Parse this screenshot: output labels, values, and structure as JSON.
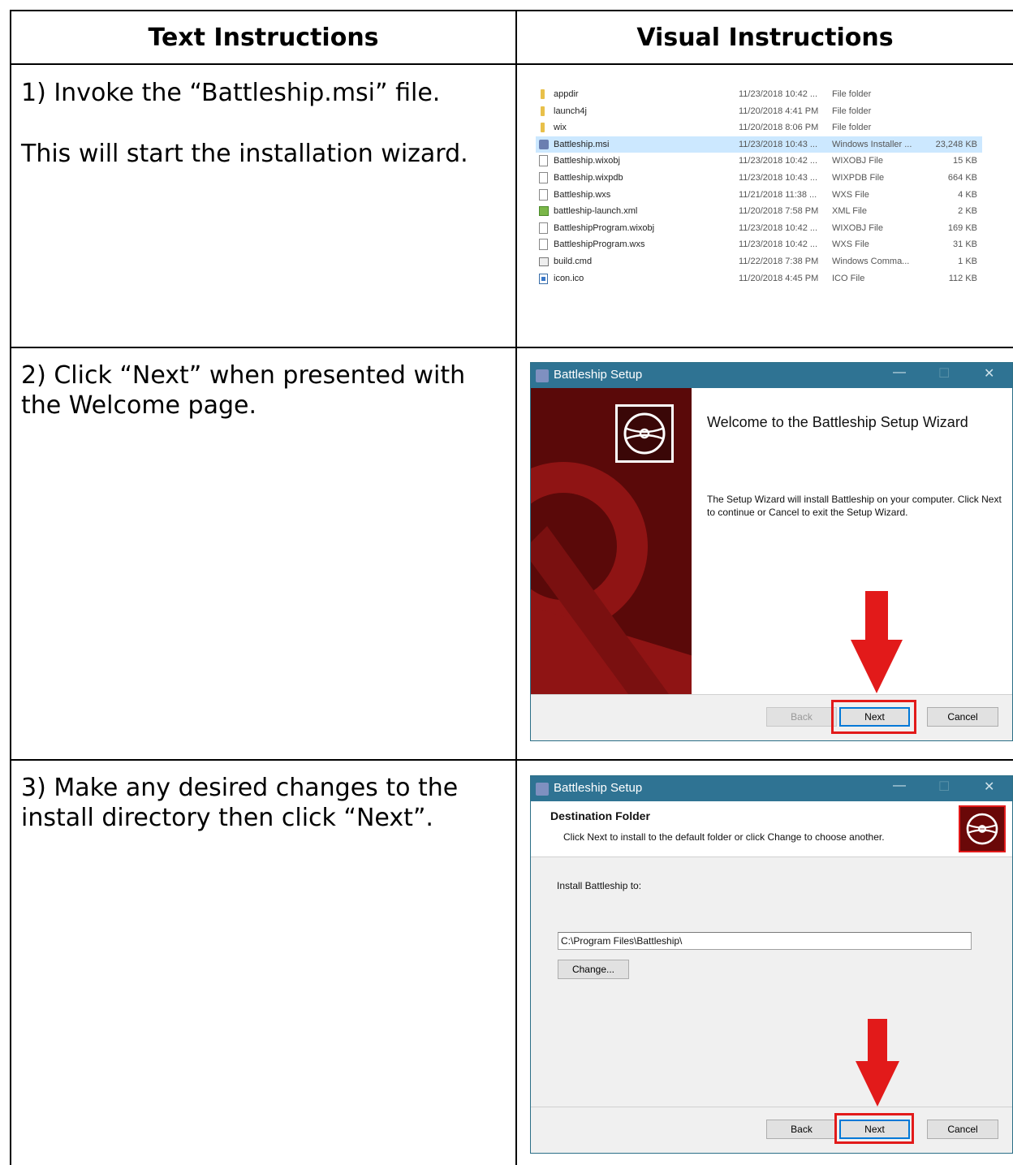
{
  "headers": {
    "text": "Text Instructions",
    "visual": "Visual Instructions"
  },
  "steps": [
    {
      "lines": [
        "1) Invoke the “Battleship.msi” file.",
        "This will start the installation wizard."
      ]
    },
    {
      "lines": [
        "2) Click “Next” when presented with the Welcome page."
      ]
    },
    {
      "lines": [
        "3) Make any desired changes to the install directory then click “Next”."
      ]
    }
  ],
  "explorer": {
    "files": [
      {
        "name": "appdir",
        "date": "11/23/2018 10:42 ...",
        "type": "File folder",
        "size": "",
        "icon": "folder-icon"
      },
      {
        "name": "launch4j",
        "date": "11/20/2018 4:41 PM",
        "type": "File folder",
        "size": "",
        "icon": "folder-icon"
      },
      {
        "name": "wix",
        "date": "11/20/2018 8:06 PM",
        "type": "File folder",
        "size": "",
        "icon": "folder-icon"
      },
      {
        "name": "Battleship.msi",
        "date": "11/23/2018 10:43 ...",
        "type": "Windows Installer ...",
        "size": "23,248 KB",
        "icon": "installer-icon",
        "selected": true
      },
      {
        "name": "Battleship.wixobj",
        "date": "11/23/2018 10:42 ...",
        "type": "WIXOBJ File",
        "size": "15 KB",
        "icon": "document-icon"
      },
      {
        "name": "Battleship.wixpdb",
        "date": "11/23/2018 10:43 ...",
        "type": "WIXPDB File",
        "size": "664 KB",
        "icon": "document-icon"
      },
      {
        "name": "Battleship.wxs",
        "date": "11/21/2018 11:38 ...",
        "type": "WXS File",
        "size": "4 KB",
        "icon": "document-icon"
      },
      {
        "name": "battleship-launch.xml",
        "date": "11/20/2018 7:58 PM",
        "type": "XML File",
        "size": "2 KB",
        "icon": "xml-icon"
      },
      {
        "name": "BattleshipProgram.wixobj",
        "date": "11/23/2018 10:42 ...",
        "type": "WIXOBJ File",
        "size": "169 KB",
        "icon": "document-icon"
      },
      {
        "name": "BattleshipProgram.wxs",
        "date": "11/23/2018 10:42 ...",
        "type": "WXS File",
        "size": "31 KB",
        "icon": "document-icon"
      },
      {
        "name": "build.cmd",
        "date": "11/22/2018 7:38 PM",
        "type": "Windows Comma...",
        "size": "1 KB",
        "icon": "cmd-icon"
      },
      {
        "name": "icon.ico",
        "date": "11/20/2018 4:45 PM",
        "type": "ICO File",
        "size": "112 KB",
        "icon": "image-icon"
      }
    ]
  },
  "wizard_welcome": {
    "title": "Battleship Setup",
    "minimize": "—",
    "maximize": "☐",
    "close": "✕",
    "heading": "Welcome to the Battleship Setup Wizard",
    "body": "The Setup Wizard will install Battleship on your computer. Click Next to continue or Cancel to exit the Setup Wizard.",
    "back": "Back",
    "next": "Next",
    "cancel": "Cancel"
  },
  "wizard_destination": {
    "title": "Battleship Setup",
    "minimize": "—",
    "maximize": "☐",
    "close": "✕",
    "heading": "Destination Folder",
    "subheading": "Click Next to install to the default folder or click Change to choose another.",
    "install_label": "Install Battleship to:",
    "path": "C:\\Program Files\\Battleship\\",
    "change": "Change...",
    "back": "Back",
    "next": "Next",
    "cancel": "Cancel"
  },
  "colors": {
    "highlight": "#e21a1a",
    "titlebar": "#2f7393",
    "banner": "#5e0a0a",
    "selection": "#cce8ff"
  }
}
